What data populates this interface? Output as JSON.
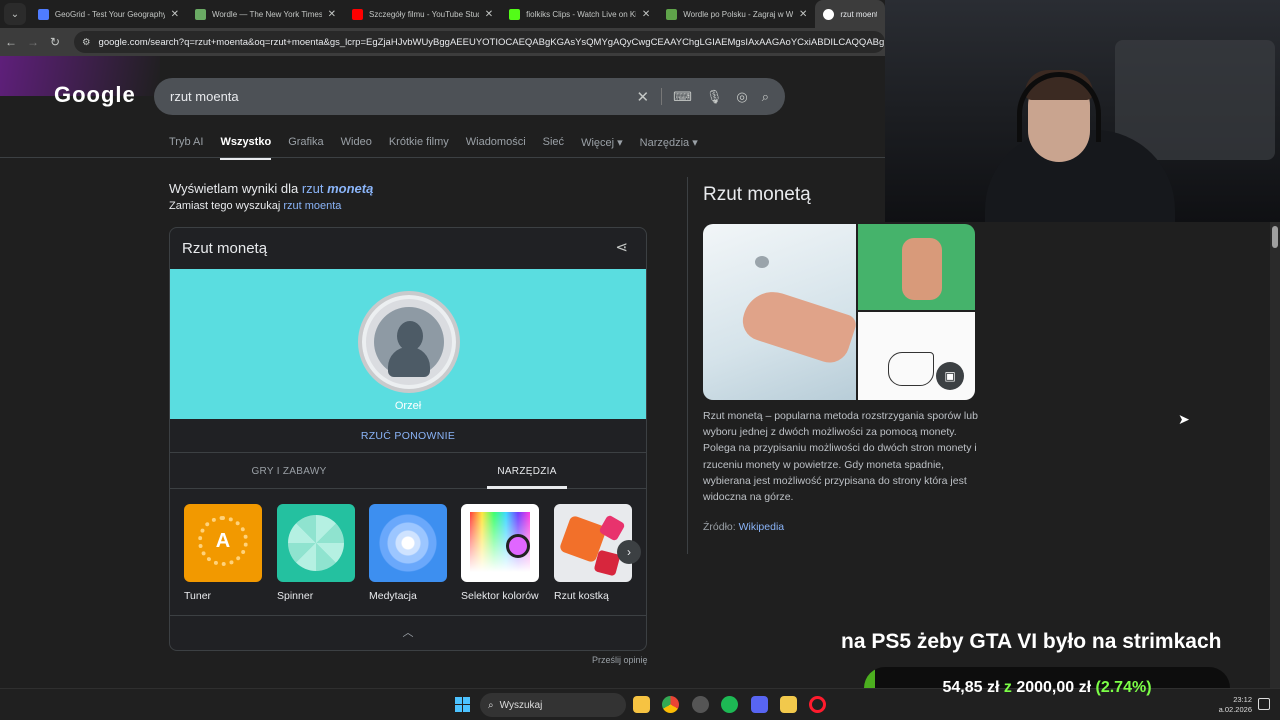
{
  "browser": {
    "tabs": [
      {
        "title": "GeoGrid - Test Your Geography",
        "favicon_color": "#4f7cff"
      },
      {
        "title": "Wordle — The New York Times",
        "favicon_color": "#6aaa64"
      },
      {
        "title": "Szczegóły filmu - YouTube Studio",
        "favicon_color": "#ff0000"
      },
      {
        "title": "fiolkiks Clips - Watch Live on Kick",
        "favicon_color": "#53fc18"
      },
      {
        "title": "Wordle po Polsku - Zagraj w Wordle",
        "favicon_color": "#5fa34a"
      },
      {
        "title": "rzut moenta",
        "favicon_color": "#ffffff",
        "active": true
      }
    ],
    "url": "google.com/search?q=rzut+moenta&oq=rzut+moenta&gs_lcrp=EgZjaHJvbWUyBggAEEUYOTIOCAEQABgKGAsYsQMYgAQyCwgCEAAYChgLGIAEMgsIAxAAGAoYCxiABDILCAQQABgKGAsYgAQ"
  },
  "search": {
    "logo": "Google",
    "query": "rzut moenta",
    "tabs": [
      "Tryb AI",
      "Wszystko",
      "Grafika",
      "Wideo",
      "Krótkie filmy",
      "Wiadomości",
      "Sieć",
      "Więcej ▾",
      "Narzędzia ▾"
    ],
    "active_tab": "Wszystko",
    "showing_prefix": "Wyświetlam wyniki dla",
    "showing_word": "rzut",
    "showing_corrected": "monetą",
    "instead_prefix": "Zamiast tego wyszukaj",
    "instead_query": "rzut moenta"
  },
  "card": {
    "title": "Rzut monetą",
    "result": "Orzeł",
    "flip_again": "RZUĆ PONOWNIE",
    "tabs": [
      "GRY I ZABAWY",
      "NARZĘDZIA"
    ],
    "tools": [
      {
        "label": "Tuner",
        "color": "#f29900"
      },
      {
        "label": "Spinner",
        "color": "#24c1a0"
      },
      {
        "label": "Medytacja",
        "color": "#3d8ff0"
      },
      {
        "label": "Selektor kolorów",
        "color": "#ffffff"
      },
      {
        "label": "Rzut kostką",
        "color": "#e8eaed"
      }
    ],
    "feedback": "Prześlij opinię"
  },
  "knowledge_panel": {
    "title": "Rzut monetą",
    "description": "Rzut monetą – popularna metoda rozstrzygania sporów lub wyboru jednej z dwóch możliwości za pomocą monety. Polega na przypisaniu możliwości do dwóch stron monety i rzuceniu monety w powietrze. Gdy moneta spadnie, wybierana jest możliwość przypisana do strony która jest widoczna na górze.",
    "source_label": "Źródło:",
    "source_link": "Wikipedia"
  },
  "overlay": {
    "ticker": "na PS5 żeby GTA VI było na strimkach",
    "goal_current": "54,85 zł",
    "goal_sep": "z",
    "goal_total": "2000,00 zł",
    "goal_percent": "(2.74%)",
    "goal_fraction": 0.0274
  },
  "taskbar": {
    "search_placeholder": "Wyszukaj",
    "time": "23:12",
    "date": "a.02.2026"
  }
}
